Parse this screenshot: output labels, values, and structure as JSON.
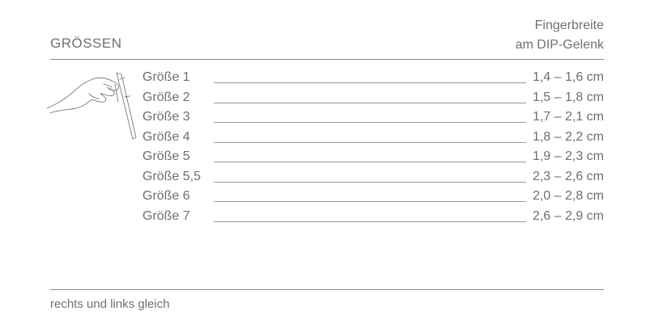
{
  "header": {
    "title": "GRÖSSEN",
    "column_header_line1": "Fingerbreite",
    "column_header_line2": "am DIP-Gelenk"
  },
  "sizes": [
    {
      "label": "Größe 1",
      "value": "1,4 – 1,6 cm"
    },
    {
      "label": "Größe 2",
      "value": "1,5 – 1,8 cm"
    },
    {
      "label": "Größe 3",
      "value": "1,7 – 2,1 cm"
    },
    {
      "label": "Größe 4",
      "value": "1,8 – 2,2 cm"
    },
    {
      "label": "Größe 5",
      "value": "1,9 – 2,3 cm"
    },
    {
      "label": "Größe 5,5",
      "value": "2,3 – 2,6 cm"
    },
    {
      "label": "Größe 6",
      "value": "2,0 – 2,8 cm"
    },
    {
      "label": "Größe 7",
      "value": "2,6 – 2,9 cm"
    }
  ],
  "footer": {
    "note": "rechts und links gleich"
  },
  "icons": {
    "illustration": "hand-caliper-icon"
  },
  "colors": {
    "text": "#6f6f6f",
    "rule": "#8c8c8c"
  }
}
